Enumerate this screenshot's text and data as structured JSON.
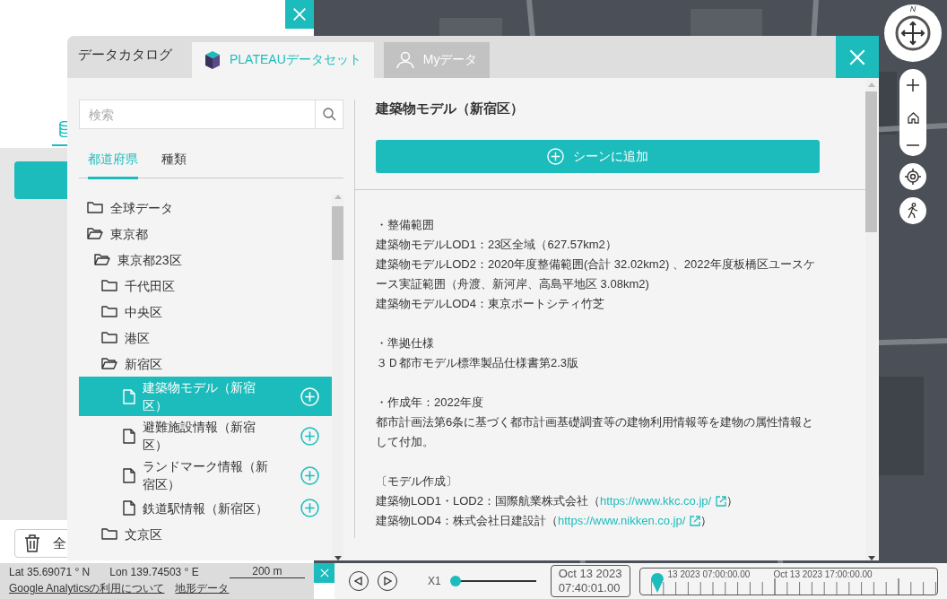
{
  "sidebar": {
    "clear_button": "全"
  },
  "window": {
    "title": "データカタログ",
    "tabs": [
      {
        "label": "PLATEAUデータセット",
        "kind": "plateau",
        "selected": true
      },
      {
        "label": "Myデータ",
        "kind": "user",
        "selected": false
      }
    ]
  },
  "search": {
    "placeholder": "検索"
  },
  "filter_tabs": [
    {
      "label": "都道府県",
      "selected": true
    },
    {
      "label": "種類",
      "selected": false
    }
  ],
  "tree": [
    {
      "label": "全球データ",
      "kind": "folder",
      "expanded": false
    },
    {
      "label": "東京都",
      "kind": "folder",
      "expanded": true,
      "children": [
        {
          "label": "東京都23区",
          "kind": "folder",
          "expanded": true,
          "children": [
            {
              "label": "千代田区",
              "kind": "folder",
              "expanded": false
            },
            {
              "label": "中央区",
              "kind": "folder",
              "expanded": false
            },
            {
              "label": "港区",
              "kind": "folder",
              "expanded": false
            },
            {
              "label": "新宿区",
              "kind": "folder",
              "expanded": true,
              "children": [
                {
                  "label": "建築物モデル（新宿区）",
                  "kind": "file",
                  "selected": true
                },
                {
                  "label": "避難施設情報（新宿区）",
                  "kind": "file",
                  "selected": false
                },
                {
                  "label": "ランドマーク情報（新宿区）",
                  "kind": "file",
                  "selected": false
                },
                {
                  "label": "鉄道駅情報（新宿区）",
                  "kind": "file",
                  "selected": false
                }
              ]
            },
            {
              "label": "文京区",
              "kind": "folder",
              "expanded": false
            }
          ]
        }
      ]
    }
  ],
  "detail": {
    "title": "建築物モデル（新宿区）",
    "add_button": "シーンに追加",
    "paragraphs": [
      [
        {
          "text": "・整備範囲"
        },
        {
          "text": "建築物モデルLOD1：23区全域（627.57km2）"
        },
        {
          "text": "建築物モデルLOD2：2020年度整備範囲(合計 32.02km2) 、2022年度板橋区ユースケース実証範囲（舟渡、新河岸、高島平地区 3.08km2)"
        },
        {
          "text": "建築物モデルLOD4：東京ポートシティ竹芝"
        }
      ],
      [
        {
          "text": "・準拠仕様"
        },
        {
          "text": "３Ｄ都市モデル標準製品仕様書第2.3版"
        }
      ],
      [
        {
          "text": "・作成年：2022年度"
        },
        {
          "text": "都市計画法第6条に基づく都市計画基礎調査等の建物利用情報等を建物の属性情報として付加。"
        }
      ],
      [
        {
          "text": "〔モデル作成〕"
        },
        {
          "text": "建築物LOD1・LOD2：国際航業株式会社（",
          "link": "https://www.kkc.co.jp/",
          "suffix": "）"
        },
        {
          "text": "建築物LOD4：株式会社日建設計（",
          "link": "https://www.nikken.co.jp/",
          "suffix": "）"
        }
      ]
    ]
  },
  "compass": {
    "north": "N"
  },
  "status_bar": {
    "lat": "Lat 35.69071 ° N",
    "lon": "Lon 139.74503 ° E",
    "scale": "200 m",
    "links": [
      "Google Analyticsの利用について",
      "地形データ"
    ]
  },
  "timeline": {
    "speed": "X1",
    "level": 0,
    "date": "Oct 13 2023",
    "time": "07:40:01.00",
    "labels": [
      "13 2023 07:00:00.00",
      "Oct 13 2023 17:00:00.00"
    ]
  }
}
